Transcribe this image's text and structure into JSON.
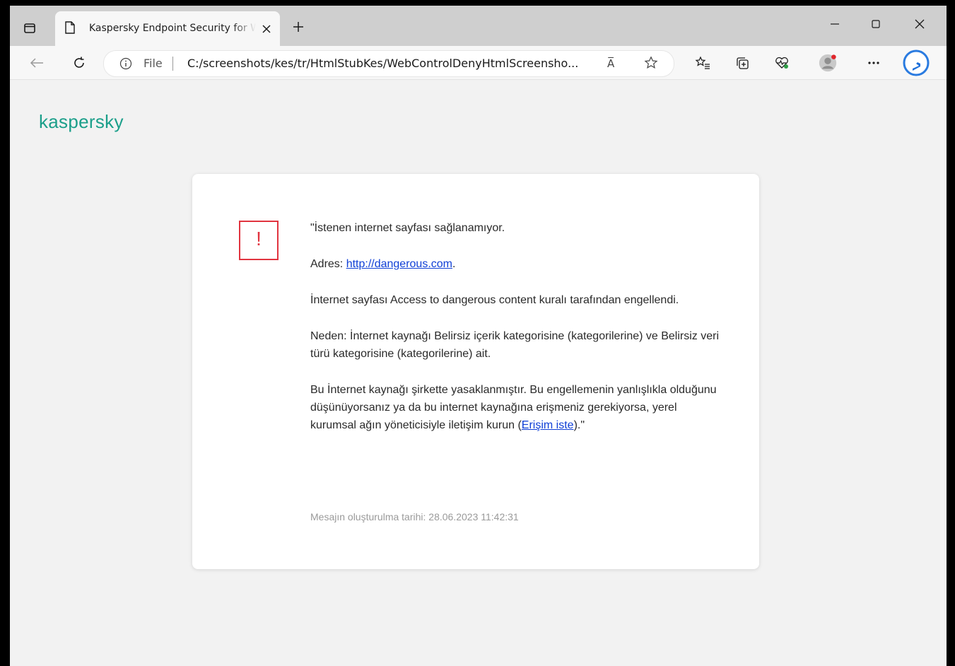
{
  "browser": {
    "tab_title": "Kaspersky Endpoint Security for Windows",
    "address": {
      "scheme_label": "File",
      "url": "C:/screenshots/kes/tr/HtmlStubKes/WebControlDenyHtmlScreensho...",
      "read_aloud_label": "A̅"
    }
  },
  "page": {
    "logo_text": "kaspersky",
    "warning_glyph": "!",
    "message": {
      "heading": "\"İstenen internet sayfası sağlanamıyor.",
      "address_prefix": "Adres: ",
      "address_link": "http://dangerous.com",
      "address_suffix": ".",
      "blocked_rule": "İnternet sayfası Access to dangerous content kuralı tarafından engellendi.",
      "reason": "Neden: İnternet kaynağı Belirsiz içerik kategorisine (kategorilerine) ve Belirsiz veri türü kategorisine (kategorilerine) ait.",
      "contact_text": "Bu İnternet kaynağı şirkette yasaklanmıştır. Bu engellemenin yanlışlıkla olduğunu düşünüyorsanız ya da bu internet kaynağına erişmeniz gerekiyorsa, yerel kurumsal ağın yöneticisiyle iletişim kurun (",
      "request_access_link": "Erişim iste",
      "contact_suffix": ").\""
    },
    "timestamp": "Mesajın oluşturulma tarihi: 28.06.2023 11:42:31"
  },
  "colors": {
    "brand": "#1b9f8a",
    "warning": "#e1343f",
    "link": "#0f3fd6"
  },
  "icons": [
    "tab-actions-icon",
    "document-icon",
    "close-icon",
    "plus-icon",
    "minimize-icon",
    "maximize-icon",
    "window-close-icon",
    "back-arrow-icon",
    "reload-icon",
    "info-icon",
    "star-icon",
    "favorites-icon",
    "collections-icon",
    "health-icon",
    "profile-icon",
    "more-icon",
    "bing-icon"
  ]
}
